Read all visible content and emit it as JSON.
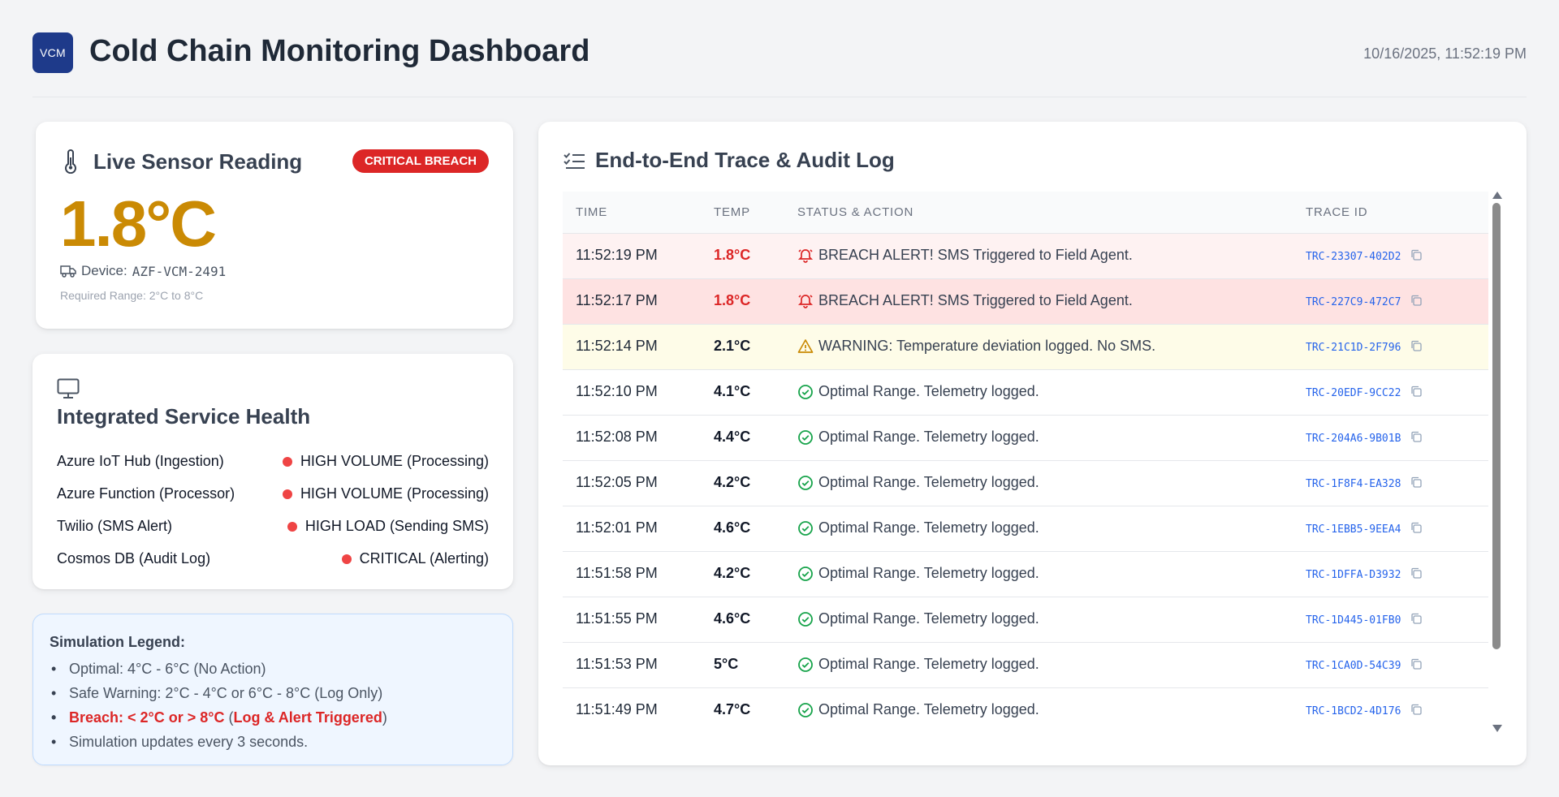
{
  "header": {
    "logo_text": "VCM",
    "title": "Cold Chain Monitoring Dashboard",
    "timestamp": "10/16/2025, 11:52:19 PM"
  },
  "sensor": {
    "title": "Live Sensor Reading",
    "badge": "CRITICAL BREACH",
    "temperature": "1.8°C",
    "device_label": "Device:",
    "device_id": "AZF-VCM-2491",
    "range_text": "Required Range: 2°C to 8°C",
    "colors": {
      "temperature": "#ca8a04",
      "badge": "#dc2626"
    }
  },
  "health": {
    "title": "Integrated Service Health",
    "services": [
      {
        "name": "Azure IoT Hub (Ingestion)",
        "status": "HIGH VOLUME (Processing)"
      },
      {
        "name": "Azure Function (Processor)",
        "status": "HIGH VOLUME (Processing)"
      },
      {
        "name": "Twilio (SMS Alert)",
        "status": "HIGH LOAD (Sending SMS)"
      },
      {
        "name": "Cosmos DB (Audit Log)",
        "status": "CRITICAL (Alerting)"
      }
    ]
  },
  "legend": {
    "title": "Simulation Legend:",
    "items": [
      "Optimal: 4°C - 6°C (No Action)",
      "Safe Warning: 2°C - 4°C or 6°C - 8°C (Log Only)",
      "Simulation updates every 3 seconds."
    ],
    "breach_prefix": "Breach: < 2°C or > 8°C",
    "breach_open": " (",
    "breach_emph": "Log & Alert Triggered",
    "breach_close": ")"
  },
  "log": {
    "title": "End-to-End Trace & Audit Log",
    "columns": [
      "TIME",
      "TEMP",
      "STATUS & ACTION",
      "TRACE ID"
    ],
    "rows": [
      {
        "time": "11:52:19 PM",
        "temp": "1.8°C",
        "status": "BREACH ALERT! SMS Triggered to Field Agent.",
        "trace": "TRC-23307-402D2",
        "level": "breach-light"
      },
      {
        "time": "11:52:17 PM",
        "temp": "1.8°C",
        "status": "BREACH ALERT! SMS Triggered to Field Agent.",
        "trace": "TRC-227C9-472C7",
        "level": "breach-strong"
      },
      {
        "time": "11:52:14 PM",
        "temp": "2.1°C",
        "status": "WARNING: Temperature deviation logged. No SMS.",
        "trace": "TRC-21C1D-2F796",
        "level": "warn"
      },
      {
        "time": "11:52:10 PM",
        "temp": "4.1°C",
        "status": "Optimal Range. Telemetry logged.",
        "trace": "TRC-20EDF-9CC22",
        "level": "ok"
      },
      {
        "time": "11:52:08 PM",
        "temp": "4.4°C",
        "status": "Optimal Range. Telemetry logged.",
        "trace": "TRC-204A6-9B01B",
        "level": "ok"
      },
      {
        "time": "11:52:05 PM",
        "temp": "4.2°C",
        "status": "Optimal Range. Telemetry logged.",
        "trace": "TRC-1F8F4-EA328",
        "level": "ok"
      },
      {
        "time": "11:52:01 PM",
        "temp": "4.6°C",
        "status": "Optimal Range. Telemetry logged.",
        "trace": "TRC-1EBB5-9EEA4",
        "level": "ok"
      },
      {
        "time": "11:51:58 PM",
        "temp": "4.2°C",
        "status": "Optimal Range. Telemetry logged.",
        "trace": "TRC-1DFFA-D3932",
        "level": "ok"
      },
      {
        "time": "11:51:55 PM",
        "temp": "4.6°C",
        "status": "Optimal Range. Telemetry logged.",
        "trace": "TRC-1D445-01FB0",
        "level": "ok"
      },
      {
        "time": "11:51:53 PM",
        "temp": "5°C",
        "status": "Optimal Range. Telemetry logged.",
        "trace": "TRC-1CA0D-54C39",
        "level": "ok"
      },
      {
        "time": "11:51:49 PM",
        "temp": "4.7°C",
        "status": "Optimal Range. Telemetry logged.",
        "trace": "TRC-1BCD2-4D176",
        "level": "ok"
      }
    ]
  },
  "icons": {
    "sensor": "thermometer-icon",
    "device": "truck-icon",
    "health": "monitor-icon",
    "log": "list-check-icon",
    "breach": "bell-alert-icon",
    "warning": "warning-triangle-icon",
    "ok": "check-circle-icon",
    "copy": "copy-icon"
  }
}
